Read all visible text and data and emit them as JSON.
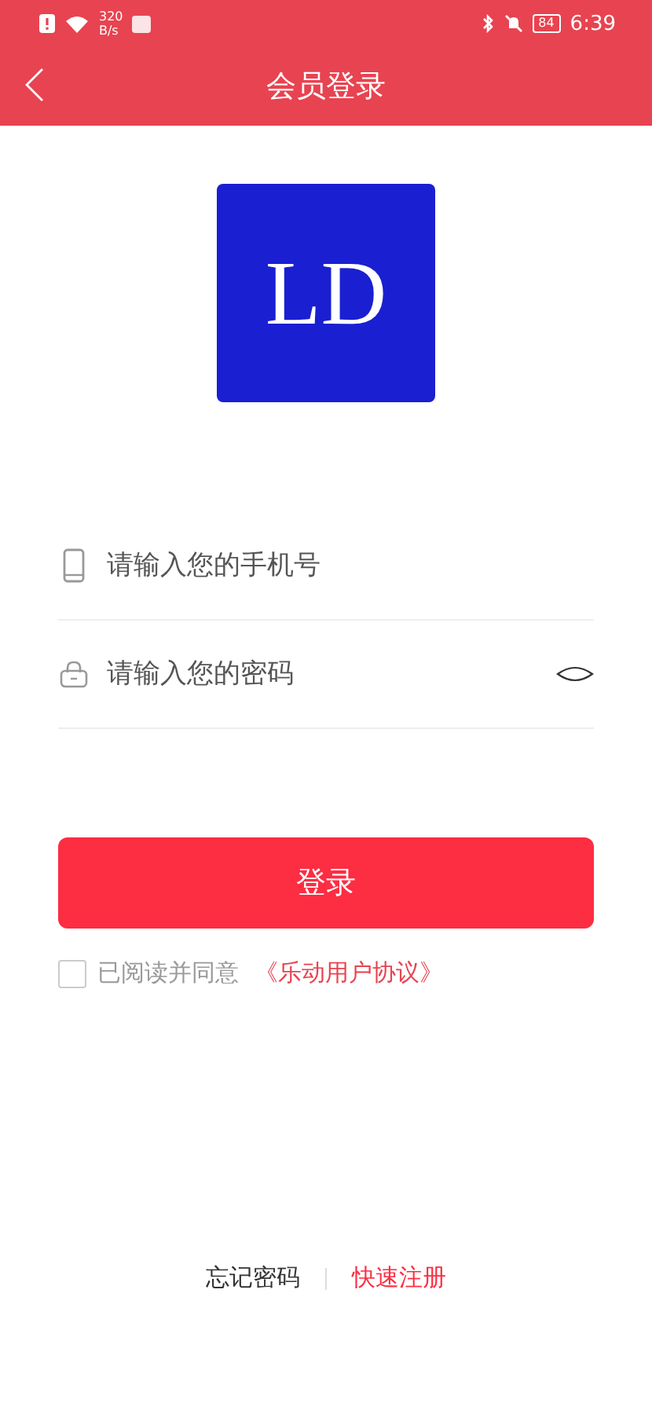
{
  "status_bar": {
    "net_speed_value": "320",
    "net_speed_unit": "B/s",
    "battery": "84",
    "time": "6:39"
  },
  "header": {
    "title": "会员登录"
  },
  "logo": {
    "text": "LD"
  },
  "fields": [
    {
      "kind": "phone",
      "placeholder": "请输入您的手机号"
    },
    {
      "kind": "password",
      "placeholder": "请输入您的密码"
    }
  ],
  "login_button": "登录",
  "agreement": {
    "checked": false,
    "text": "已阅读并同意",
    "link": "《乐动用户协议》"
  },
  "footer": {
    "forgot": "忘记密码",
    "register": "快速注册"
  }
}
